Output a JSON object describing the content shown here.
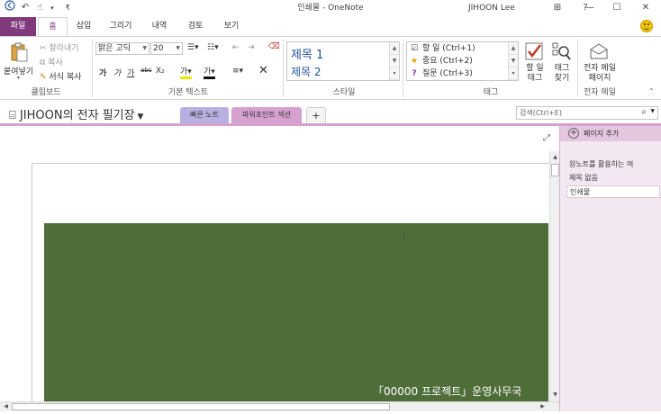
{
  "window": {
    "title": "인쇄물 - OneNote",
    "user": "JIHOON Lee",
    "controls": {
      "minimize": "—",
      "restore": "☐",
      "close": "✕",
      "ribbon_display": "⊞",
      "help": "?"
    }
  },
  "quick_access": {
    "back": "◀",
    "undo": "↶",
    "touch": "☝",
    "more": "▾"
  },
  "tabs": [
    "파일",
    "홈",
    "삽입",
    "그리기",
    "내역",
    "검토",
    "보기"
  ],
  "ribbon": {
    "clipboard": {
      "paste": "붙여넣기",
      "cut": "잘라내기",
      "copy": "복사",
      "format_painter": "서식 복사",
      "label": "클립보드"
    },
    "basic_text": {
      "font": "맑은 고딕",
      "size": "20",
      "bold": "가",
      "italic": "가",
      "underline": "가",
      "strike": "abc",
      "subscript": "X₂",
      "highlight": "가",
      "font_color": "가",
      "label": "기본 텍스트"
    },
    "styles": {
      "items": [
        "제목 1",
        "제목 2"
      ],
      "label": "스타일"
    },
    "tags": {
      "items": [
        "할 일 (Ctrl+1)",
        "중요 (Ctrl+2)",
        "질문 (Ctrl+3)"
      ],
      "todo_button": "할 일\n태그",
      "find_button": "태그\n찾기",
      "label": "태그"
    },
    "email": {
      "button": "전자 메일\n페이지",
      "label": "전자 메일"
    }
  },
  "notebook": {
    "title": "JIHOON의 전자 필기장",
    "sections": [
      "빠른 노트",
      "파워포인트 섹션",
      "+"
    ],
    "search_placeholder": "검색(Ctrl+E)"
  },
  "page": {
    "slide_caption": "「00000 프로젝트」운영사무국",
    "slide_color": "#4e6d38"
  },
  "pages_pane": {
    "add_page": "페이지 추가",
    "items": [
      "원노트를 활용하는 여",
      "제목 없음",
      "인쇄물"
    ]
  }
}
